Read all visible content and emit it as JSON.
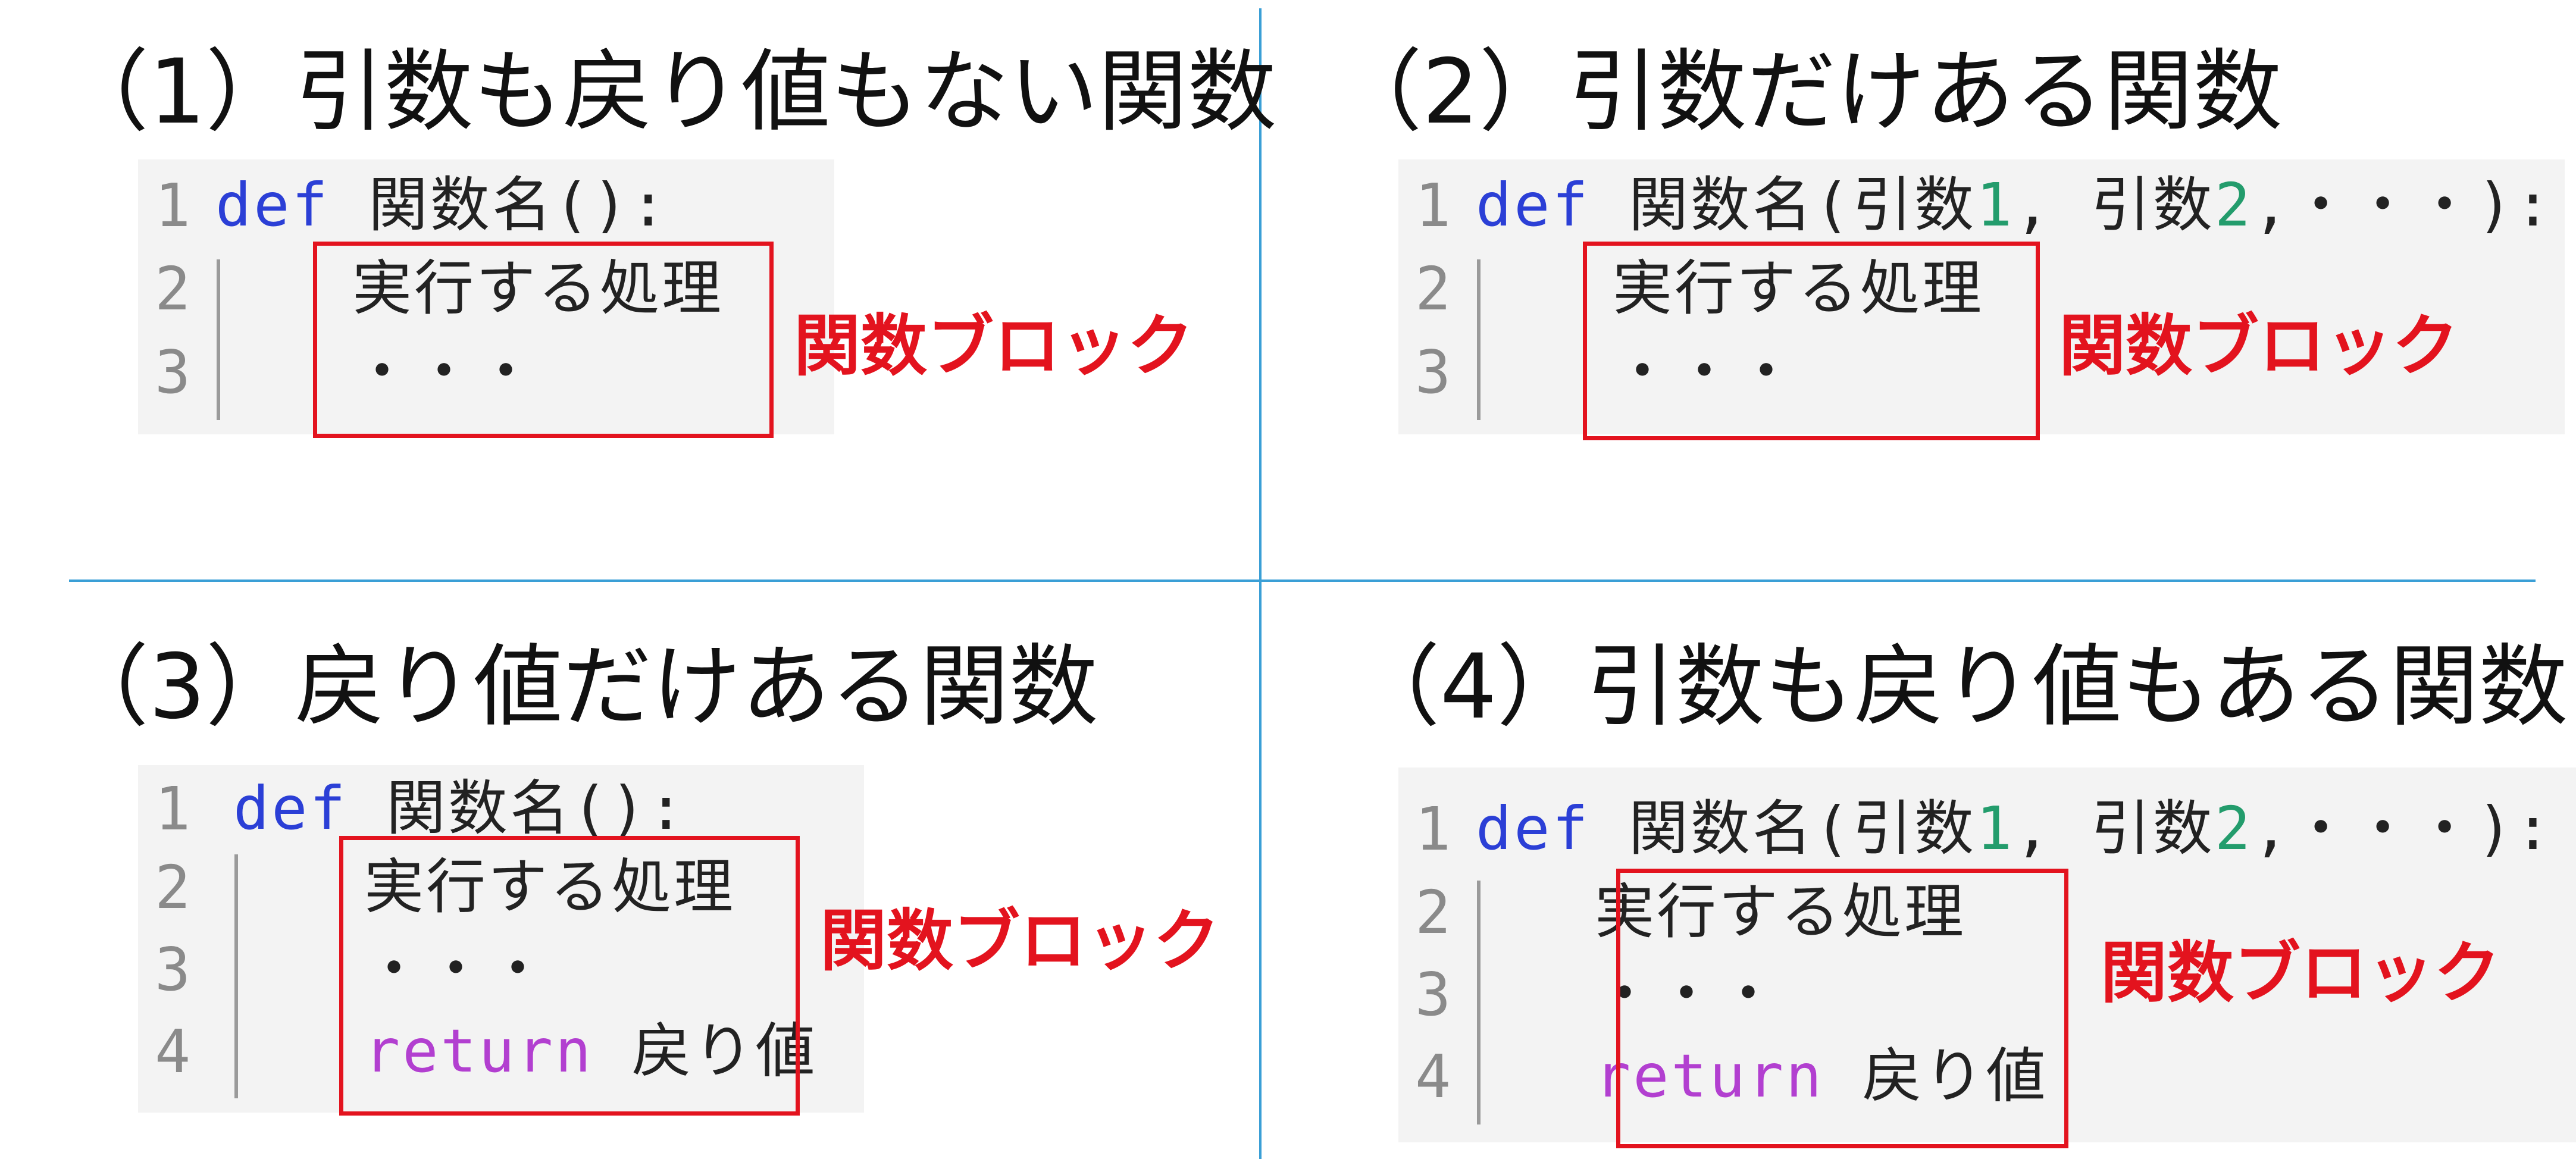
{
  "quadrants": [
    {
      "title": "（1）引数も戻り値もない関数",
      "lines": [
        {
          "num": "1",
          "def": "def",
          "name": "関数名():"
        },
        {
          "num": "2",
          "text": "実行する処理"
        },
        {
          "num": "3",
          "text": "・・・"
        }
      ],
      "block_label": "関数ブロック"
    },
    {
      "title": "（2）引数だけある関数",
      "lines": [
        {
          "num": "1",
          "def": "def",
          "name": "関数名(引数",
          "p1": "1",
          "sep": ", 引数",
          "p2": "2",
          "tail": ",・・・):"
        },
        {
          "num": "2",
          "text": "実行する処理"
        },
        {
          "num": "3",
          "text": "・・・"
        }
      ],
      "block_label": "関数ブロック"
    },
    {
      "title": "（3）戻り値だけある関数",
      "lines": [
        {
          "num": "1",
          "def": "def",
          "name": "関数名():"
        },
        {
          "num": "2",
          "text": "実行する処理"
        },
        {
          "num": "3",
          "text": "・・・"
        },
        {
          "num": "4",
          "ret": "return",
          "value": "戻り値"
        }
      ],
      "block_label": "関数ブロック"
    },
    {
      "title": "（4）引数も戻り値もある関数",
      "lines": [
        {
          "num": "1",
          "def": "def",
          "name": "関数名(引数",
          "p1": "1",
          "sep": ", 引数",
          "p2": "2",
          "tail": ",・・・):"
        },
        {
          "num": "2",
          "text": "実行する処理"
        },
        {
          "num": "3",
          "text": "・・・"
        },
        {
          "num": "4",
          "ret": "return",
          "value": "戻り値"
        }
      ],
      "block_label": "関数ブロック"
    }
  ],
  "colors": {
    "divider": "#3a9fd6",
    "highlight": "#e3131e",
    "keyword_def": "#2b3fd6",
    "keyword_return": "#b23fd0",
    "number_literal": "#239c6c",
    "code_background": "#f3f3f3"
  }
}
